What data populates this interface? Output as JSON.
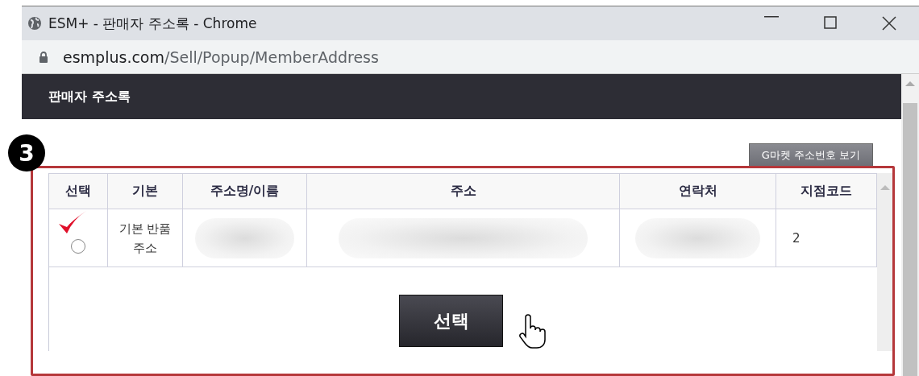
{
  "window": {
    "title": "ESM+ - 판매자 주소록 - Chrome"
  },
  "address_bar": {
    "domain": "esmplus.com",
    "path": "/Sell/Popup/MemberAddress"
  },
  "page_header": {
    "title": "판매자 주소록"
  },
  "step_badge": "3",
  "gmarket_button": "G마켓 주소번호 보기",
  "table": {
    "columns": [
      "선택",
      "기본",
      "주소명/이름",
      "주소",
      "연락처",
      "지점코드"
    ],
    "rows": [
      {
        "cells": [
          {
            "kind": "radio",
            "selected": false
          },
          {
            "kind": "text",
            "text": "기본 반품 주소"
          },
          {
            "kind": "redacted"
          },
          {
            "kind": "redacted"
          },
          {
            "kind": "redacted"
          },
          {
            "kind": "text",
            "text": "2"
          }
        ]
      }
    ]
  },
  "select_button": "선택"
}
